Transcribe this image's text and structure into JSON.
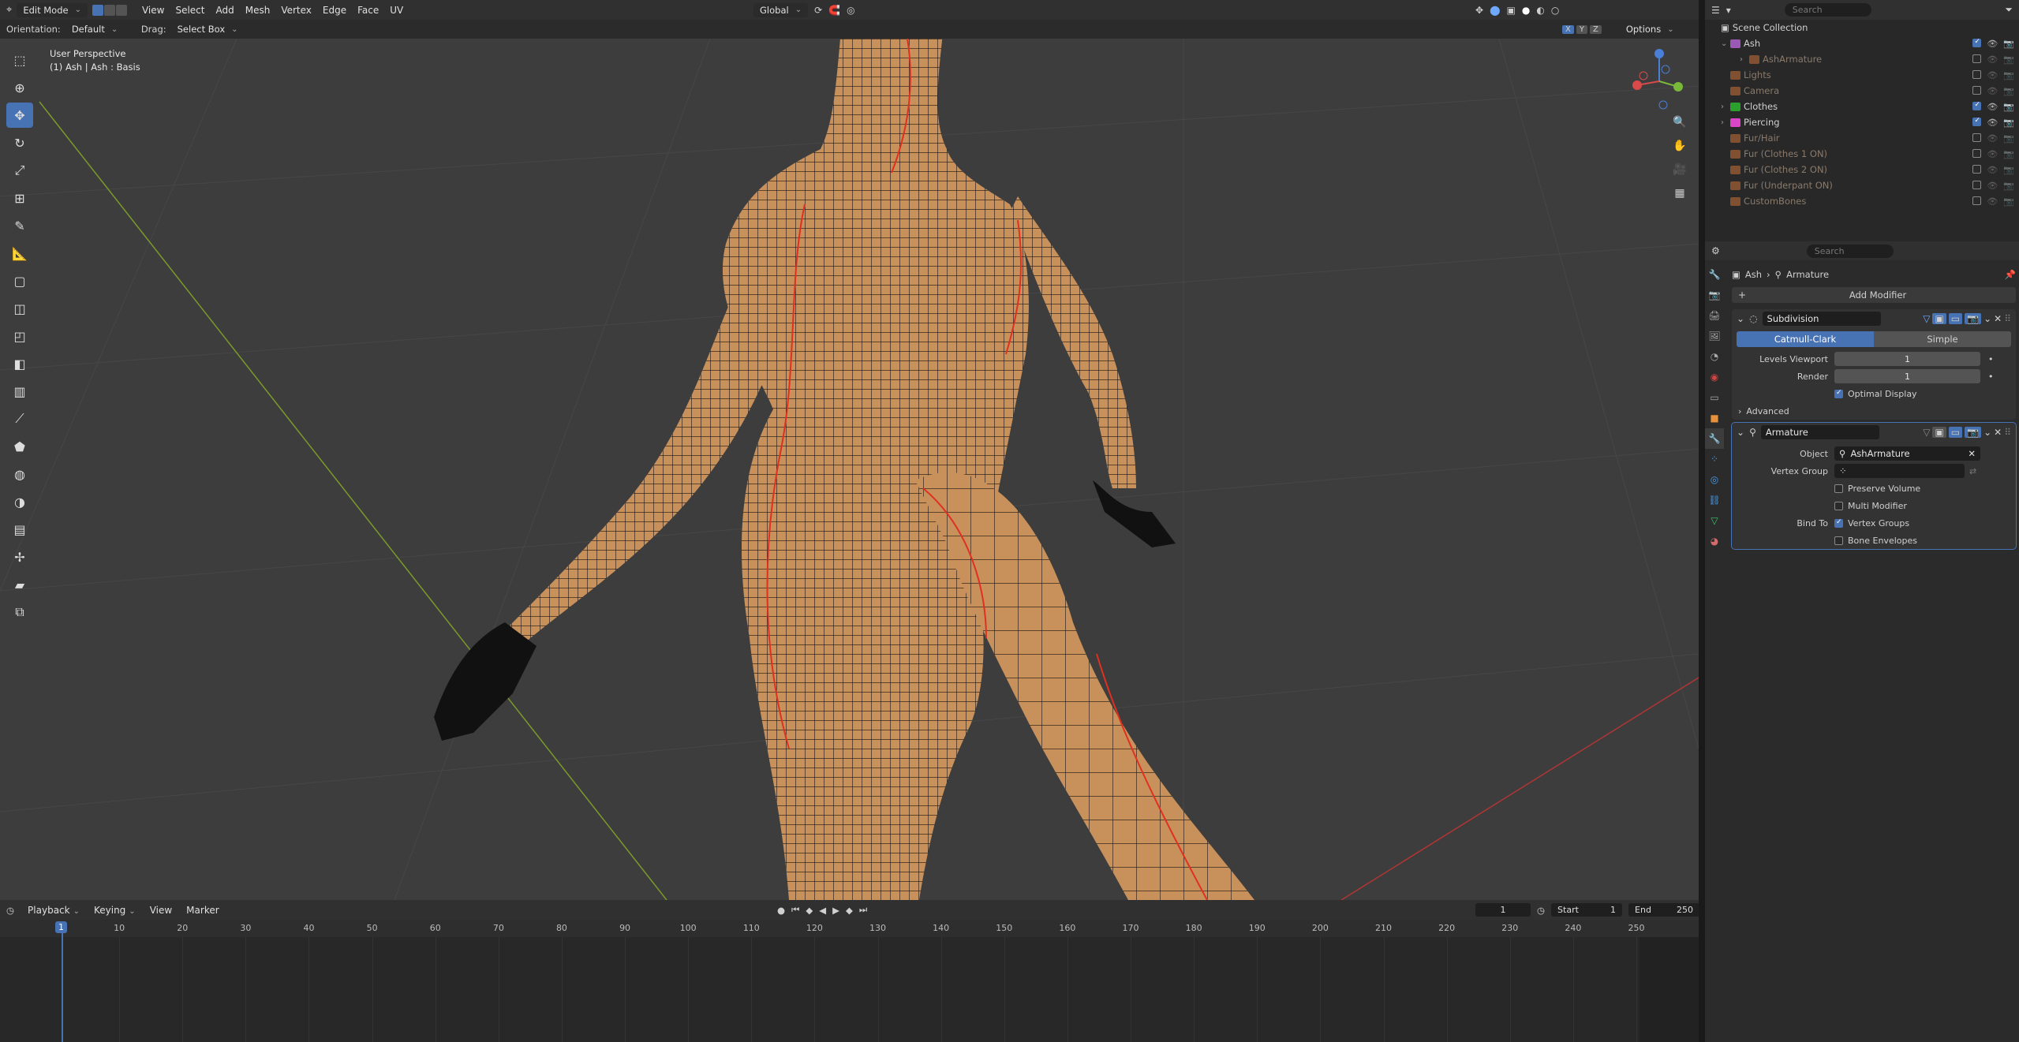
{
  "header": {
    "mode": "Edit Mode",
    "menus": [
      "View",
      "Select",
      "Add",
      "Mesh",
      "Vertex",
      "Edge",
      "Face",
      "UV"
    ],
    "transform_orientation": "Global",
    "search_placeholder": "Search"
  },
  "subheader": {
    "orientation_label": "Orientation:",
    "orientation_value": "Default",
    "drag_label": "Drag:",
    "drag_value": "Select Box",
    "axes": [
      "X",
      "Y",
      "Z"
    ],
    "options_label": "Options"
  },
  "viewport": {
    "perspective": "User Perspective",
    "object_info": "(1) Ash | Ash : Basis",
    "mesh_color": "#c8915c",
    "seam_color": "#e03020"
  },
  "outliner": {
    "search_placeholder": "Search",
    "scene_collection": "Scene Collection",
    "items": [
      {
        "name": "Ash",
        "color": "#9b59b6",
        "checked": true,
        "dim": false
      },
      {
        "name": "AshArmature",
        "color": "#c87137",
        "checked": false,
        "dim": true
      },
      {
        "name": "Lights",
        "color": "#c87137",
        "checked": false,
        "dim": true
      },
      {
        "name": "Camera",
        "color": "#c87137",
        "checked": false,
        "dim": true
      },
      {
        "name": "Clothes",
        "color": "#2ca02c",
        "checked": true,
        "dim": false
      },
      {
        "name": "Piercing",
        "color": "#d946c8",
        "checked": true,
        "dim": false
      },
      {
        "name": "Fur/Hair",
        "color": "#c87137",
        "checked": false,
        "dim": true
      },
      {
        "name": "Fur (Clothes 1 ON)",
        "color": "#c87137",
        "checked": false,
        "dim": true
      },
      {
        "name": "Fur (Clothes 2 ON)",
        "color": "#c87137",
        "checked": false,
        "dim": true
      },
      {
        "name": "Fur (Underpant ON)",
        "color": "#c87137",
        "checked": false,
        "dim": true
      },
      {
        "name": "CustomBones",
        "color": "#c87137",
        "checked": false,
        "dim": true
      }
    ]
  },
  "properties": {
    "search_placeholder": "Search",
    "breadcrumb_object": "Ash",
    "breadcrumb_modifier": "Armature",
    "add_modifier": "Add Modifier",
    "subdivision": {
      "name": "Subdivision",
      "catmull": "Catmull-Clark",
      "simple": "Simple",
      "levels_viewport_label": "Levels Viewport",
      "levels_viewport": "1",
      "render_label": "Render",
      "render": "1",
      "optimal_display": "Optimal Display",
      "advanced": "Advanced"
    },
    "armature": {
      "name": "Armature",
      "object_label": "Object",
      "object_value": "AshArmature",
      "vertex_group_label": "Vertex Group",
      "preserve_volume": "Preserve Volume",
      "multi_modifier": "Multi Modifier",
      "bind_to_label": "Bind To",
      "vertex_groups": "Vertex Groups",
      "bone_envelopes": "Bone Envelopes"
    }
  },
  "timeline": {
    "menus": [
      "Playback",
      "Keying",
      "View",
      "Marker"
    ],
    "current_frame": "1",
    "start_label": "Start",
    "start": "1",
    "end_label": "End",
    "end": "250",
    "ticks": [
      "1",
      "10",
      "20",
      "30",
      "40",
      "50",
      "60",
      "70",
      "80",
      "90",
      "100",
      "110",
      "120",
      "130",
      "140",
      "150",
      "160",
      "170",
      "180",
      "190",
      "200",
      "210",
      "220",
      "230",
      "240",
      "250"
    ]
  }
}
